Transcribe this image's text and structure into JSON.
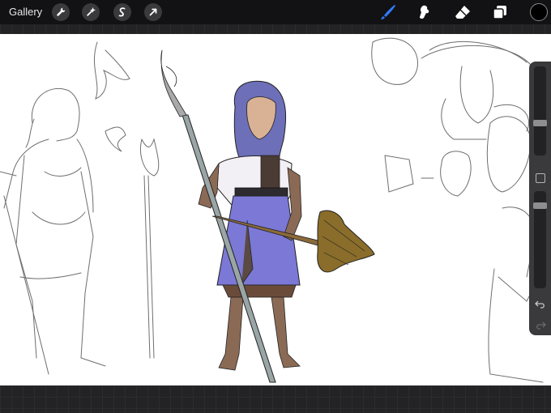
{
  "toolbar": {
    "gallery_label": "Gallery",
    "left_tools": [
      {
        "icon": "wrench-icon"
      },
      {
        "icon": "magic-wand-icon"
      },
      {
        "icon": "selection-icon"
      },
      {
        "icon": "transform-arrow-icon"
      }
    ],
    "right_tools": [
      {
        "icon": "brush-icon",
        "active": true,
        "color": "#2f7bff"
      },
      {
        "icon": "smudge-icon",
        "active": false,
        "color": "#ffffff"
      },
      {
        "icon": "eraser-icon",
        "active": false,
        "color": "#ffffff"
      },
      {
        "icon": "layers-icon",
        "active": false,
        "color": "#ffffff"
      }
    ],
    "current_color": "#000000"
  },
  "sidebar": {
    "brush_size_level": 0.25,
    "opacity_level": 0.25,
    "icons": [
      "modify-button-icon",
      "undo-icon",
      "redo-icon"
    ]
  },
  "canvas": {
    "background": "#ffffff",
    "content": "character-sketch-artwork"
  }
}
